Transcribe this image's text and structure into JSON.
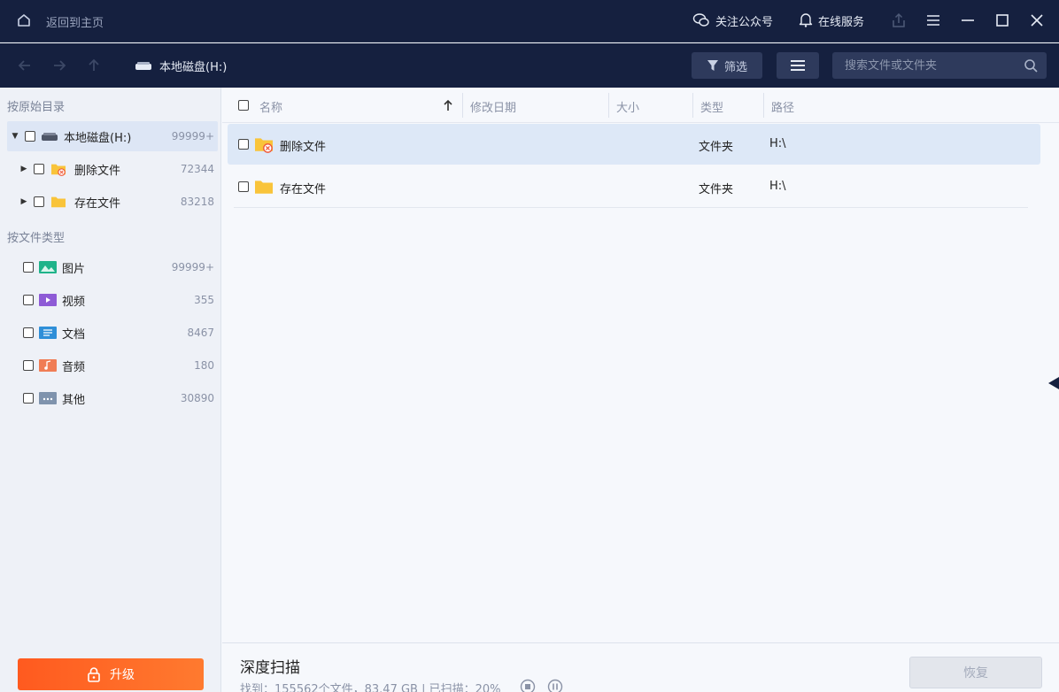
{
  "titlebar": {
    "back_home": "返回到主页",
    "follow_label": "关注公众号",
    "service_label": "在线服务"
  },
  "navbar": {
    "drive_label": "本地磁盘(H:)",
    "filter_label": "筛选",
    "search_placeholder": "搜索文件或文件夹"
  },
  "sidebar": {
    "section_original": "按原始目录",
    "section_type": "按文件类型",
    "tree": [
      {
        "label": "本地磁盘(H:)",
        "count": "99999+",
        "icon": "drive-icon"
      },
      {
        "label": "删除文件",
        "count": "72344",
        "icon": "deleted-folder-icon"
      },
      {
        "label": "存在文件",
        "count": "83218",
        "icon": "folder-icon"
      }
    ],
    "types": [
      {
        "label": "图片",
        "count": "99999+",
        "icon": "image-icon",
        "color": "#1fb38a"
      },
      {
        "label": "视频",
        "count": "355",
        "icon": "video-icon",
        "color": "#8e5bd6"
      },
      {
        "label": "文档",
        "count": "8467",
        "icon": "document-icon",
        "color": "#2f8fd8"
      },
      {
        "label": "音频",
        "count": "180",
        "icon": "audio-icon",
        "color": "#f07d55"
      },
      {
        "label": "其他",
        "count": "30890",
        "icon": "other-icon",
        "color": "#7f93ad"
      }
    ],
    "upgrade_label": "升级"
  },
  "table": {
    "columns": [
      "名称",
      "修改日期",
      "大小",
      "类型",
      "路径"
    ],
    "rows": [
      {
        "name": "删除文件",
        "date": "",
        "size": "",
        "type": "文件夹",
        "path": "H:\\",
        "icon": "deleted-folder-icon"
      },
      {
        "name": "存在文件",
        "date": "",
        "size": "",
        "type": "文件夹",
        "path": "H:\\",
        "icon": "folder-icon"
      }
    ]
  },
  "footer": {
    "scan_title": "深度扫描",
    "scan_status": "找到：155562个文件，83.47 GB | 已扫描：20%",
    "recover_label": "恢复"
  },
  "colors": {
    "titlebar_bg": "#15203f",
    "accent_orange": "#ff6a24",
    "folder_yellow": "#f9c43a"
  }
}
